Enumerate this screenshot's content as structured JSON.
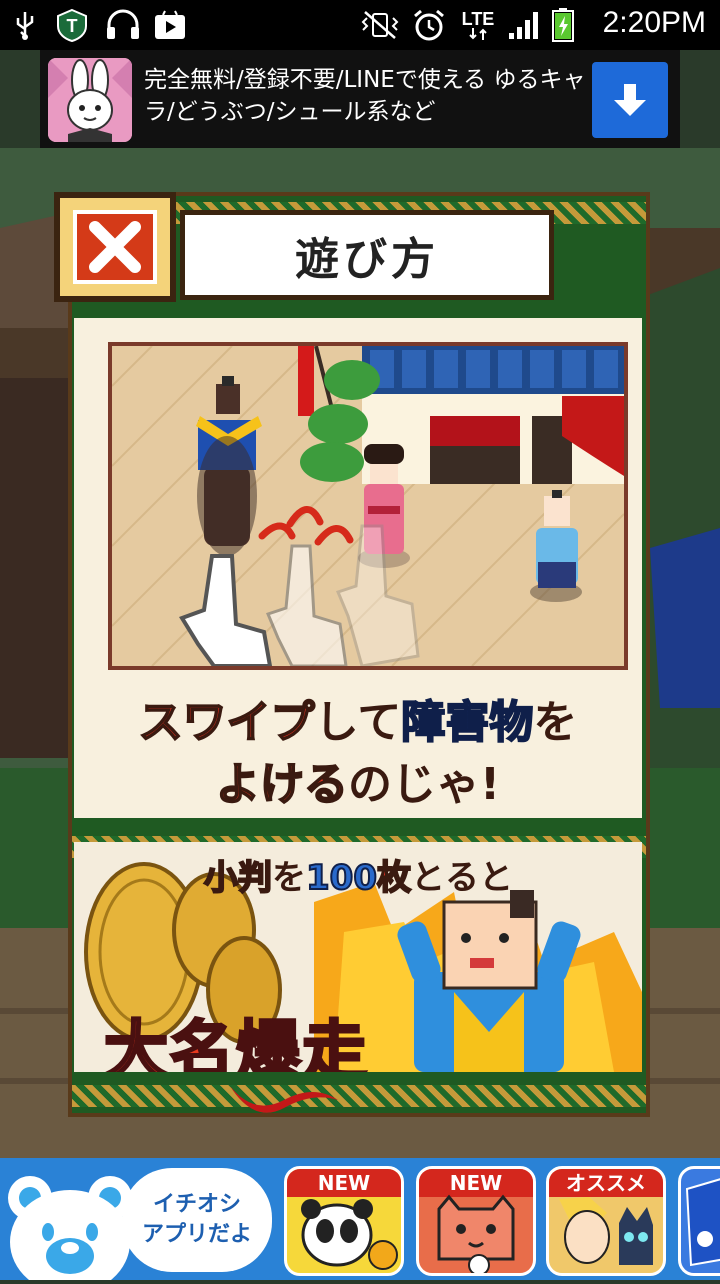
{
  "status_bar": {
    "time": "2:20PM",
    "network": "LTE",
    "icons": [
      "usb-icon",
      "shield-t-icon",
      "headphones-icon",
      "play-store-icon",
      "vibrate-icon",
      "alarm-icon",
      "lte-icon",
      "signal-icon",
      "battery-icon"
    ]
  },
  "ad_banner": {
    "text": "完全無料/登録不要/LINEで使える ゆるキャラ/どうぶつ/シュール系など",
    "download_icon": "download-arrow-icon"
  },
  "dialog": {
    "title": "遊び方",
    "close_icon": "close-x-icon",
    "instruction_line1_a": "スワイプ",
    "instruction_line1_b": "して",
    "instruction_line1_c": "障害物",
    "instruction_line1_d": "を",
    "instruction_line2_a": "よける",
    "instruction_line2_b": "のじゃ!",
    "bonus_caption_a": "小判",
    "bonus_caption_b": "を",
    "bonus_caption_c": "100",
    "bonus_caption_d": "枚",
    "bonus_caption_e": "とると",
    "bonus_result": "大名爆走"
  },
  "bottom_bar": {
    "speech_line1": "イチオシ",
    "speech_line2": "アプリだよ",
    "apps": [
      {
        "badge": "NEW"
      },
      {
        "badge": "NEW"
      },
      {
        "badge": "オススメ"
      }
    ]
  }
}
